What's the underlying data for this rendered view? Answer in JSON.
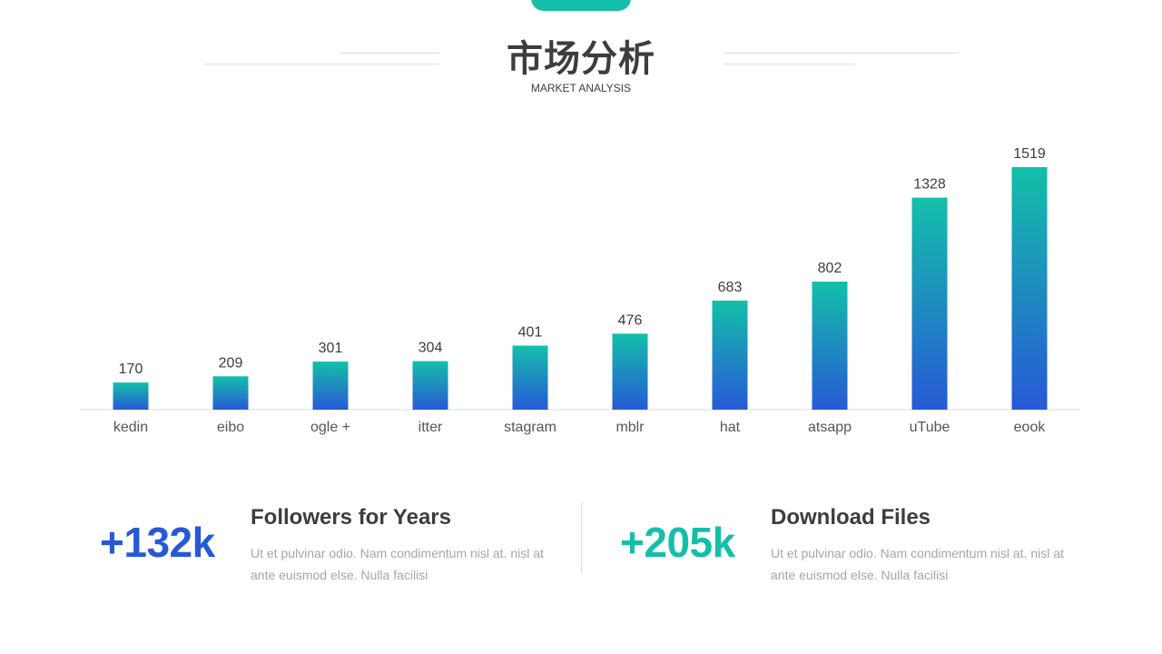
{
  "header": {
    "title": "市场分析",
    "subtitle": "MARKET ANALYSIS"
  },
  "colors": {
    "accent_teal": "#14bfa9",
    "accent_blue": "#2759d6",
    "text_dark": "#3d3d3d",
    "text_muted": "#a6a6a6"
  },
  "chart_data": {
    "type": "bar",
    "categories": [
      "kedin",
      "eibo",
      "ogle +",
      "itter",
      "stagram",
      "mblr",
      "hat",
      "atsapp",
      "uTube",
      "eook"
    ],
    "values": [
      170,
      209,
      301,
      304,
      401,
      476,
      683,
      802,
      1328,
      1519
    ],
    "title": "",
    "xlabel": "",
    "ylabel": "",
    "ylim": [
      0,
      1600
    ],
    "grid": false,
    "bar_gradient": [
      "#14bfa9",
      "#2759d6"
    ]
  },
  "stats": [
    {
      "value": "+132k",
      "heading": "Followers for Years",
      "description": "Ut et pulvinar odio. Nam condimentum nisl at. nisl at ante euismod else. Nulla facilisi",
      "color": "#2759d6"
    },
    {
      "value": "+205k",
      "heading": "Download Files",
      "description": "Ut et pulvinar odio. Nam condimentum nisl at. nisl at ante euismod else. Nulla facilisi",
      "color": "#14bfa9"
    }
  ]
}
